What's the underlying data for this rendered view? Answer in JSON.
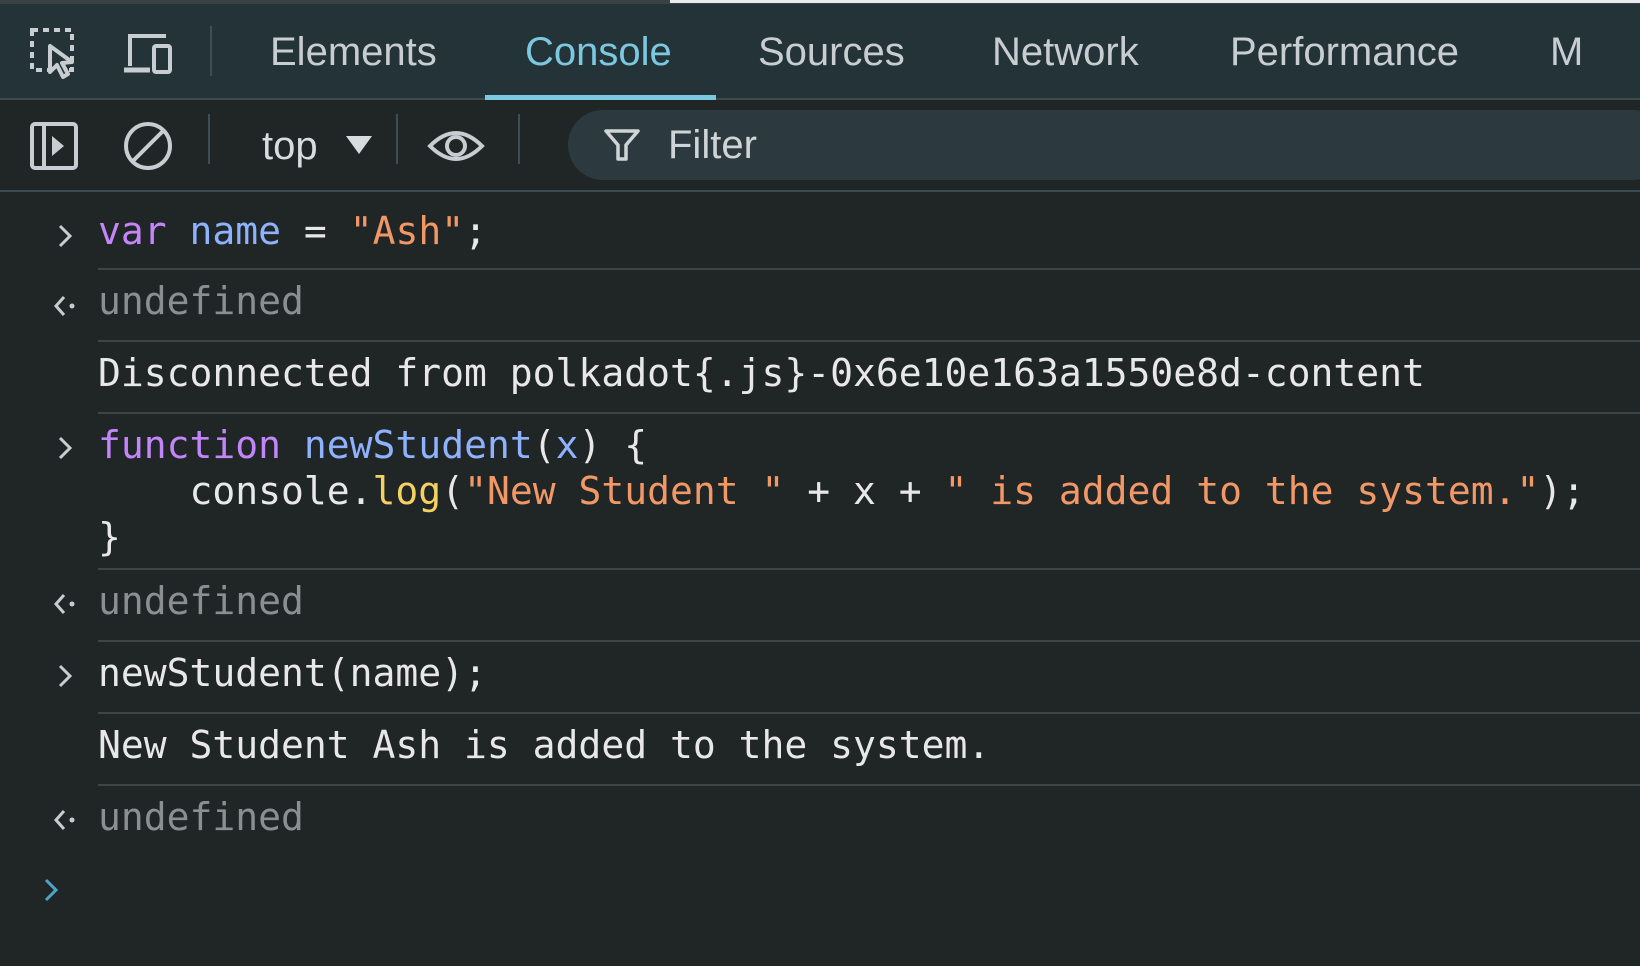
{
  "tabs": [
    {
      "label": "Elements",
      "active": false
    },
    {
      "label": "Console",
      "active": true
    },
    {
      "label": "Sources",
      "active": false
    },
    {
      "label": "Network",
      "active": false
    },
    {
      "label": "Performance",
      "active": false
    },
    {
      "label": "M",
      "active": false
    }
  ],
  "toolbar": {
    "context": "top",
    "filter_placeholder": "Filter"
  },
  "console": {
    "input1": {
      "kw": "var",
      "name": "name",
      "eq": " = ",
      "str": "\"Ash\"",
      "end": ";"
    },
    "result1": "undefined",
    "message1": "Disconnected from polkadot{.js}-0x6e10e163a1550e8d-content",
    "input2": {
      "line1": {
        "kw": "function",
        "fn": "newStudent",
        "open": "(",
        "param": "x",
        "close": ") {"
      },
      "line2": {
        "obj": "console.",
        "method": "log",
        "open": "(",
        "s1": "\"New Student \"",
        "mid": " + x + ",
        "s2": "\" is added to the system.\"",
        "close": ");"
      },
      "line3": "}"
    },
    "result2": "undefined",
    "input3": "newStudent(name);",
    "log1": "New Student Ash is added to the system.",
    "result3": "undefined"
  },
  "colors": {
    "keyword": "#c386fa",
    "variable": "#8fb2ff",
    "string": "#f29766",
    "function": "#f5d162",
    "active_tab": "#7cc8e0"
  },
  "icons": [
    "inspect-element-icon",
    "device-toggle-icon",
    "sidebar-toggle-icon",
    "clear-console-icon",
    "eye-icon",
    "filter-icon",
    "chevron-right-icon",
    "return-arrow-icon"
  ]
}
